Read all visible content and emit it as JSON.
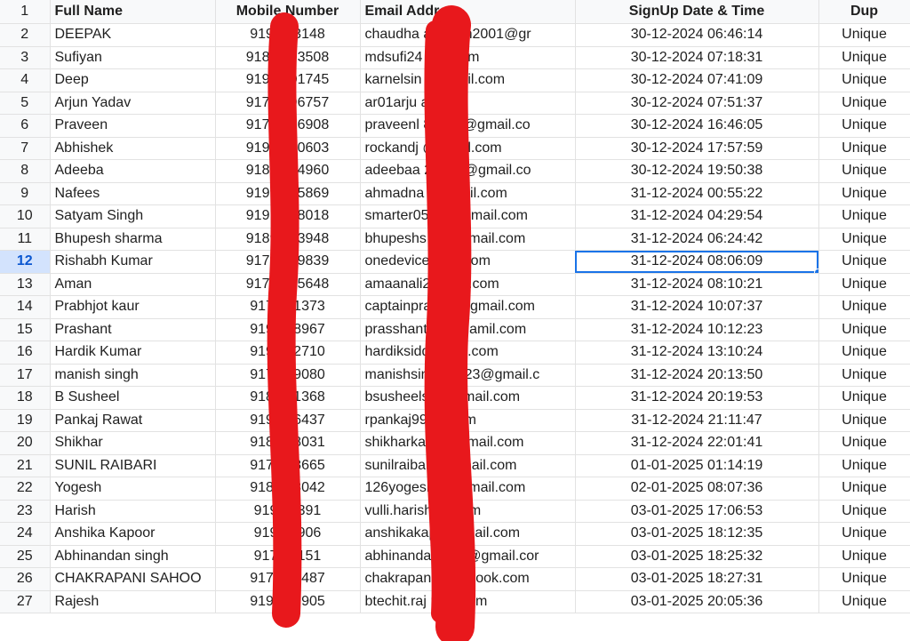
{
  "sheet": {
    "header": {
      "row_number": "1",
      "full_name": "Full Name",
      "mobile_number": "Mobile Number",
      "email_address": "Email Address",
      "signup_datetime": "SignUp Date & Time",
      "dup": "Dup"
    },
    "selected_cell": "31-12-2024 08:06:09",
    "active_row": "12",
    "rows": [
      {
        "num": "2",
        "name": "DEEPAK",
        "mobile": "9197  53148",
        "email": "chaudha      aksingh2001@gr",
        "datetime": "30-12-2024 06:46:14",
        "dup": "Unique"
      },
      {
        "num": "3",
        "name": "Sufiyan",
        "mobile": "91800  93508",
        "email": "mdsufi24        nail.com",
        "datetime": "30-12-2024 07:18:31",
        "dup": "Unique"
      },
      {
        "num": "4",
        "name": "Deep",
        "mobile": "91928  01745",
        "email": "karnelsin          @gmail.com",
        "datetime": "30-12-2024 07:41:09",
        "dup": "Unique"
      },
      {
        "num": "5",
        "name": "Arjun Yadav",
        "mobile": "91775  96757",
        "email": "ar01arju           ail.com",
        "datetime": "30-12-2024 07:51:37",
        "dup": "Unique"
      },
      {
        "num": "6",
        "name": "Praveen",
        "mobile": "91720  66908",
        "email": "praveenl        88455@gmail.co",
        "datetime": "30-12-2024 16:46:05",
        "dup": "Unique"
      },
      {
        "num": "7",
        "name": "Abhishek",
        "mobile": "91999  30603",
        "email": "rockandj          @gmail.com",
        "datetime": "30-12-2024 17:57:59",
        "dup": "Unique"
      },
      {
        "num": "8",
        "name": "Adeeba",
        "mobile": "91892  24960",
        "email": "adeebaa         23456@gmail.co",
        "datetime": "30-12-2024 19:50:38",
        "dup": "Unique"
      },
      {
        "num": "9",
        "name": "Nafees",
        "mobile": "91997  35869",
        "email": "ahmadna          @gmail.com",
        "datetime": "31-12-2024 00:55:22",
        "dup": "Unique"
      },
      {
        "num": "10",
        "name": "Satyam Singh",
        "mobile": "91913  18018",
        "email": "smarter05         02@gmail.com",
        "datetime": "31-12-2024 04:29:54",
        "dup": "Unique"
      },
      {
        "num": "11",
        "name": "Bhupesh sharma",
        "mobile": "91890  33948",
        "email": "bhupeshs          67@gmail.com",
        "datetime": "31-12-2024 06:24:42",
        "dup": "Unique"
      },
      {
        "num": "12",
        "name": "Rishabh Kumar",
        "mobile": "91798  39839",
        "email": "onedevice          mail.com",
        "datetime": "31-12-2024 08:06:09",
        "dup": "Unique"
      },
      {
        "num": "13",
        "name": "Aman",
        "mobile": "91730  35648",
        "email": "amaanali2         gmail.com",
        "datetime": "31-12-2024 08:10:21",
        "dup": "Unique"
      },
      {
        "num": "14",
        "name": "Prabhjot kaur",
        "mobile": "91721  1373",
        "email": "captainpra         aur@gmail.com",
        "datetime": "31-12-2024 10:07:37",
        "dup": "Unique"
      },
      {
        "num": "15",
        "name": "Prashant",
        "mobile": "91982  8967",
        "email": "prasshantp         5@gamil.com",
        "datetime": "31-12-2024 10:12:23",
        "dup": "Unique"
      },
      {
        "num": "16",
        "name": "Hardik Kumar",
        "mobile": "91948  2710",
        "email": "hardiksidd          gmail.com",
        "datetime": "31-12-2024 13:10:24",
        "dup": "Unique"
      },
      {
        "num": "17",
        "name": "manish singh",
        "mobile": "91701  9080",
        "email": "manishsin          uhan23@gmail.c",
        "datetime": "31-12-2024 20:13:50",
        "dup": "Unique"
      },
      {
        "num": "18",
        "name": "B Susheel",
        "mobile": "91830  1368",
        "email": "bsusheels          4@gmail.com",
        "datetime": "31-12-2024 20:19:53",
        "dup": "Unique"
      },
      {
        "num": "19",
        "name": "Pankaj Rawat",
        "mobile": "91956  6437",
        "email": "rpankaj99          ail.com",
        "datetime": "31-12-2024 21:11:47",
        "dup": "Unique"
      },
      {
        "num": "20",
        "name": "Shikhar",
        "mobile": "91827  8031",
        "email": "shikharkati         8@gmail.com",
        "datetime": "31-12-2024 22:01:41",
        "dup": "Unique"
      },
      {
        "num": "21",
        "name": "SUNIL RAIBARI",
        "mobile": "91789  8665",
        "email": "sunilraibari          @gmail.com",
        "datetime": "01-01-2025 01:14:19",
        "dup": "Unique"
      },
      {
        "num": "22",
        "name": "Yogesh",
        "mobile": "91895  8042",
        "email": "126yogeshg          @gmail.com",
        "datetime": "02-01-2025 08:07:36",
        "dup": "Unique"
      },
      {
        "num": "23",
        "name": "Harish",
        "mobile": "91997  391",
        "email": "vulli.harish         ail.com",
        "datetime": "03-01-2025 17:06:53",
        "dup": "Unique"
      },
      {
        "num": "24",
        "name": "Anshika Kapoor",
        "mobile": "91997  906",
        "email": "anshikakap          @gmail.com",
        "datetime": "03-01-2025 18:12:35",
        "dup": "Unique"
      },
      {
        "num": "25",
        "name": "Abhinandan singh",
        "mobile": "91759  151",
        "email": "abhinandan          e10@gmail.cor",
        "datetime": "03-01-2025 18:25:32",
        "dup": "Unique"
      },
      {
        "num": "26",
        "name": "CHAKRAPANI SAHOO",
        "mobile": "91700  7487",
        "email": "chakrapani          @outlook.com",
        "datetime": "03-01-2025 18:27:31",
        "dup": "Unique"
      },
      {
        "num": "27",
        "name": "Rajesh",
        "mobile": "91945  9905",
        "email": "btechit.raj          mail.com",
        "datetime": "03-01-2025 20:05:36",
        "dup": "Unique"
      }
    ]
  },
  "colors": {
    "redaction": "#e8181c",
    "selection": "#1a73e8",
    "header_bg": "#f8f9fa",
    "grid_line": "#e2e2e2"
  }
}
